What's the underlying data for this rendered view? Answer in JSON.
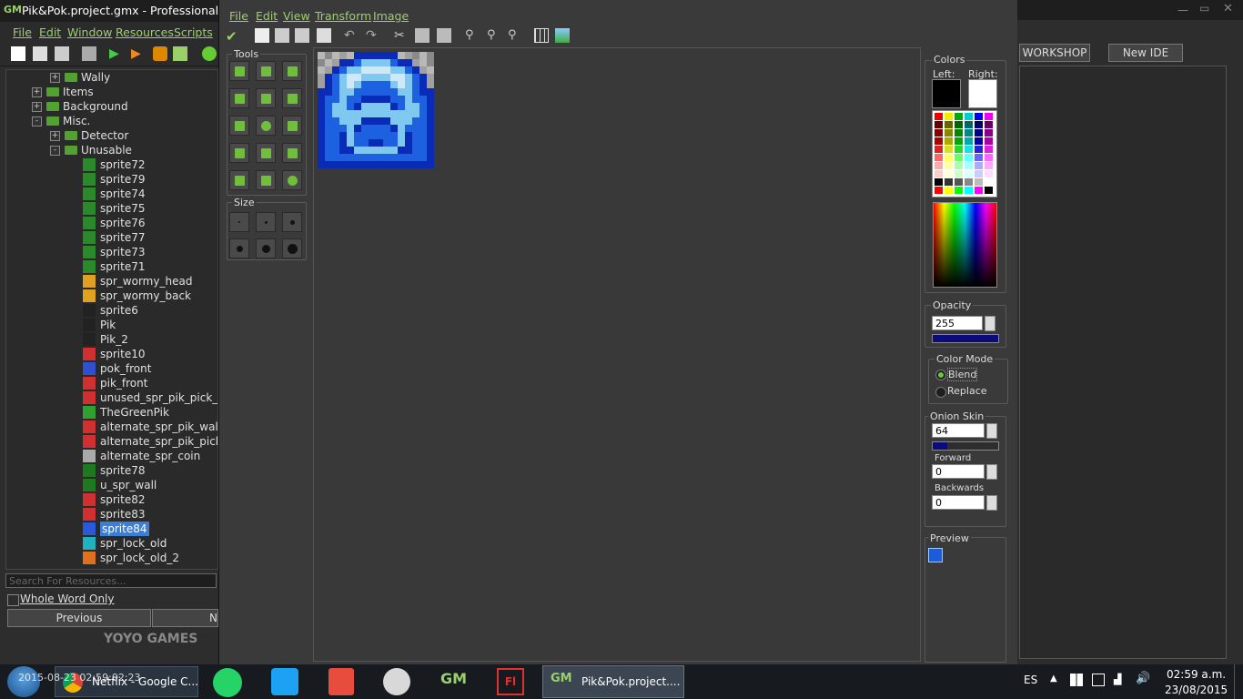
{
  "gm": {
    "title": "Pik&Pok.project.gmx  -  Professional Edi",
    "menus": [
      "File",
      "Edit",
      "Window",
      "Resources",
      "Scripts"
    ],
    "tree": [
      {
        "label": "Wally",
        "type": "folder",
        "depth": 2,
        "expander": "+"
      },
      {
        "label": "Items",
        "type": "folder",
        "depth": 1,
        "expander": "+"
      },
      {
        "label": "Background",
        "type": "folder",
        "depth": 1,
        "expander": "+"
      },
      {
        "label": "Misc.",
        "type": "folder",
        "depth": 1,
        "expander": "-"
      },
      {
        "label": "Detector",
        "type": "folder",
        "depth": 2,
        "expander": "+"
      },
      {
        "label": "Unusable",
        "type": "folder",
        "depth": 2,
        "expander": "-"
      },
      {
        "label": "sprite72",
        "type": "sprite",
        "color": "#2a8a2a"
      },
      {
        "label": "sprite79",
        "type": "sprite",
        "color": "#2a8a2a"
      },
      {
        "label": "sprite74",
        "type": "sprite",
        "color": "#2a8a2a"
      },
      {
        "label": "sprite75",
        "type": "sprite",
        "color": "#2a8a2a"
      },
      {
        "label": "sprite76",
        "type": "sprite",
        "color": "#2a8a2a"
      },
      {
        "label": "sprite77",
        "type": "sprite",
        "color": "#2a8a2a"
      },
      {
        "label": "sprite73",
        "type": "sprite",
        "color": "#2a8a2a"
      },
      {
        "label": "sprite71",
        "type": "sprite",
        "color": "#2a8a2a"
      },
      {
        "label": "spr_wormy_head",
        "type": "sprite",
        "color": "#e0a020"
      },
      {
        "label": "spr_wormy_back",
        "type": "sprite",
        "color": "#e0a020"
      },
      {
        "label": "sprite6",
        "type": "sprite",
        "color": "#222"
      },
      {
        "label": "Pik",
        "type": "sprite",
        "color": "#222"
      },
      {
        "label": "Pik_2",
        "type": "sprite",
        "color": "#222"
      },
      {
        "label": "sprite10",
        "type": "sprite",
        "color": "#d03030"
      },
      {
        "label": "pok_front",
        "type": "sprite",
        "color": "#3050d0"
      },
      {
        "label": "pik_front",
        "type": "sprite",
        "color": "#d03030"
      },
      {
        "label": "unused_spr_pik_pick_jump",
        "type": "sprite",
        "color": "#d03030"
      },
      {
        "label": "TheGreenPik",
        "type": "sprite",
        "color": "#30a030"
      },
      {
        "label": "alternate_spr_pik_walk_lef",
        "type": "sprite",
        "color": "#d03030"
      },
      {
        "label": "alternate_spr_pik_pick_wa",
        "type": "sprite",
        "color": "#d03030"
      },
      {
        "label": "alternate_spr_coin",
        "type": "sprite",
        "color": "#aaaaaa"
      },
      {
        "label": "sprite78",
        "type": "sprite",
        "color": "#1e7a1e"
      },
      {
        "label": "u_spr_wall",
        "type": "sprite",
        "color": "#1e7a1e"
      },
      {
        "label": "sprite82",
        "type": "sprite",
        "color": "#d03030"
      },
      {
        "label": "sprite83",
        "type": "sprite",
        "color": "#d03030"
      },
      {
        "label": "sprite84",
        "type": "sprite",
        "color": "#2a5ad8",
        "selected": true
      },
      {
        "label": "spr_lock_old",
        "type": "sprite",
        "color": "#20b0c0"
      },
      {
        "label": "spr_lock_old_2",
        "type": "sprite",
        "color": "#e07020"
      }
    ],
    "search_placeholder": "Search For Resources...",
    "whole_word": "Whole Word Only",
    "previous": "Previous",
    "next": "N",
    "brand": "YOYO GAMES"
  },
  "editor": {
    "menus": [
      "File",
      "Edit",
      "View",
      "Transform",
      "Image"
    ],
    "tools_title": "Tools",
    "size_title": "Size",
    "colors_title": "Colors",
    "left_label": "Left:",
    "right_label": "Right:",
    "opacity_title": "Opacity",
    "opacity_value": "255",
    "colormode_title": "Color Mode",
    "blend_label": "Blend",
    "replace_label": "Replace",
    "onion_title": "Onion Skin",
    "onion_value": "64",
    "forward_label": "Forward",
    "forward_value": "0",
    "backwards_label": "Backwards",
    "backwards_value": "0",
    "preview_title": "Preview",
    "left_color": "#000000",
    "right_color": "#ffffff"
  },
  "ide": {
    "workshop": "WORKSHOP",
    "new_ide": "New IDE"
  },
  "taskbar": {
    "chrome_label": "Netflix - Google C...",
    "active_label": "Pik&Pok.project....",
    "lang": "ES",
    "time": "02:59 a.m.",
    "date": "23/08/2015",
    "overlay": "2015-08-23 02:59:02:23"
  }
}
